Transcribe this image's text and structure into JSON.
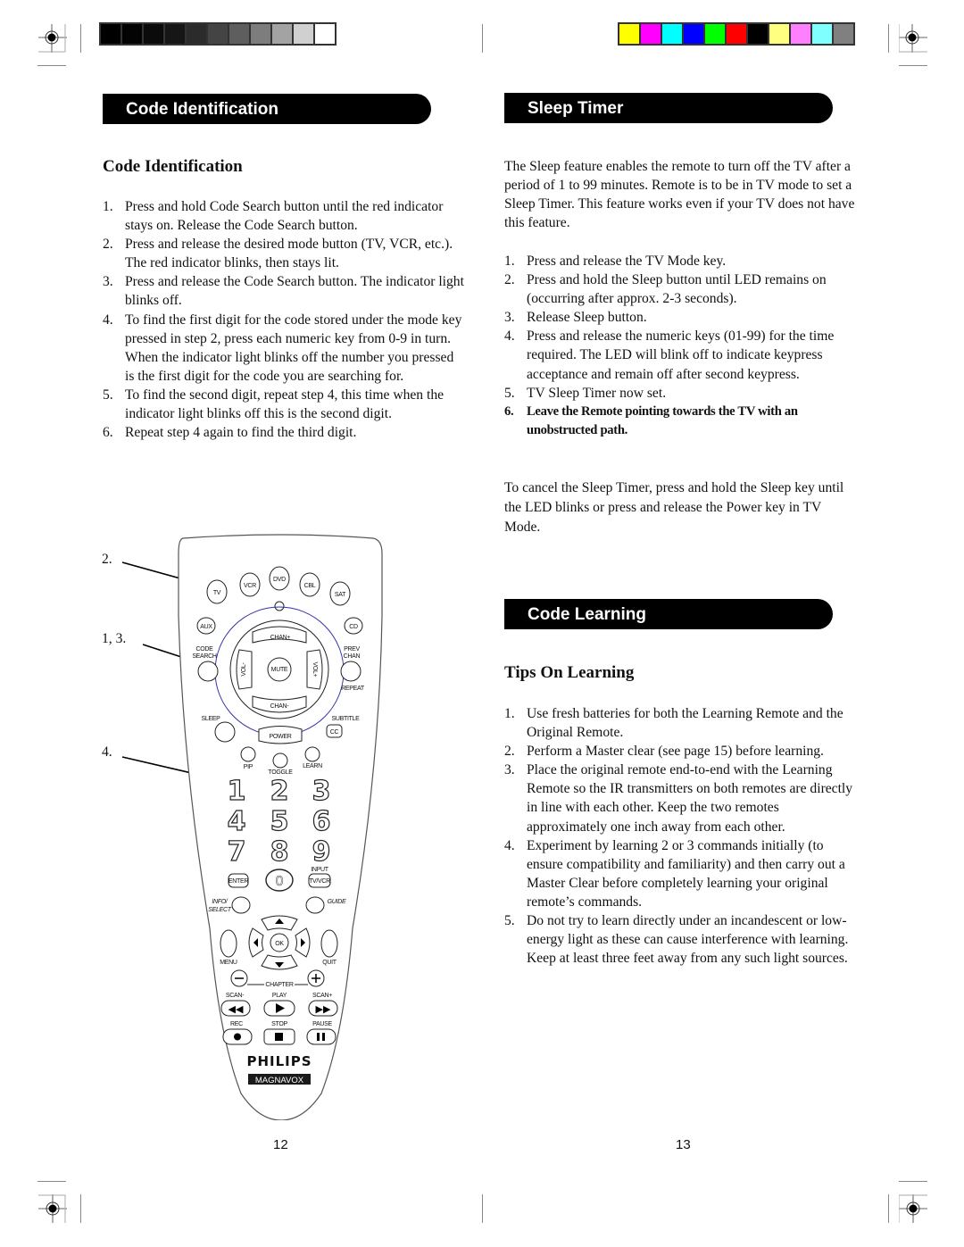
{
  "print_marks": {
    "grayscale_bar": [
      "#000000",
      "#030303",
      "#0b0b0b",
      "#161616",
      "#2b2b2b",
      "#444444",
      "#5e5e5e",
      "#7d7d7d",
      "#a3a3a3",
      "#d0d0d0",
      "#ffffff"
    ],
    "color_bar": [
      "#ffff00",
      "#ff00ff",
      "#00ffff",
      "#0000ff",
      "#00ff00",
      "#ff0000",
      "#000000",
      "#ffff80",
      "#ff80ff",
      "#80ffff",
      "#808080"
    ]
  },
  "left_page": {
    "banner": "Code Identification",
    "heading": "Code Identification",
    "steps": [
      {
        "num": "1.",
        "text": "Press and hold Code Search button until the red indicator stays on. Release the Code Search button."
      },
      {
        "num": "2.",
        "text": "Press and release the desired mode button (TV, VCR, etc.).",
        "note": "The red indicator blinks, then stays lit."
      },
      {
        "num": "3.",
        "text": "Press and release the Code Search button. The indicator light blinks off."
      },
      {
        "num": "4.",
        "text": "To find the first digit for the code stored under the mode key pressed in step 2, press each numeric key from 0-9 in turn. When the indicator light blinks off the number you pressed is the first digit for the code you are searching for."
      },
      {
        "num": "5.",
        "text": "To find the second digit, repeat step 4, this time when the indicator light blinks off this is the second digit."
      },
      {
        "num": "6.",
        "text": "Repeat step 4 again to find the third digit."
      }
    ],
    "callouts": [
      "2.",
      "1, 3.",
      "4."
    ],
    "page_number": "12"
  },
  "remote": {
    "mode_keys": [
      "TV",
      "VCR",
      "DVD",
      "CBL",
      "SAT"
    ],
    "aux": "AUX",
    "cd": "CD",
    "code_search": [
      "CODE",
      "SEARCH"
    ],
    "prev_chan": [
      "PREV",
      "CHAN"
    ],
    "repeat": "REPEAT",
    "chan_up": "CHAN+",
    "chan_down": "CHAN-",
    "vol_down": "VOL-",
    "vol_up": "VOL+",
    "mute": "MUTE",
    "sleep": "SLEEP",
    "subtitle": "SUBTITLE",
    "cc": "CC",
    "power": "POWER",
    "pip": "PIP",
    "toggle": "TOGGLE",
    "learn": "LEARN",
    "digits": [
      "1",
      "2",
      "3",
      "4",
      "5",
      "6",
      "7",
      "8",
      "9",
      "0"
    ],
    "enter": "ENTER",
    "input": "INPUT",
    "tvvcr": "TV/VCR",
    "info_select": [
      "INFO/",
      "SELECT"
    ],
    "guide": "GUIDE",
    "ok": "OK",
    "menu": "MENU",
    "quit": "QUIT",
    "chapter": "CHAPTER",
    "scan_down": "SCAN-",
    "play": "PLAY",
    "scan_up": "SCAN+",
    "rec": "REC",
    "stop": "STOP",
    "pause": "PAUSE",
    "brand": "PHILIPS",
    "sub_brand": "MAGNAVOX",
    "ring_color": "#3333aa"
  },
  "right_page": {
    "sleep_banner": "Sleep Timer",
    "sleep_intro": "The Sleep feature enables the remote to turn off the TV after a period of 1 to 99 minutes. Remote is to be in TV mode to set a Sleep Timer. This feature works even if your TV does not have this feature.",
    "sleep_steps": [
      {
        "num": "1.",
        "text": "Press and release the TV Mode key."
      },
      {
        "num": "2.",
        "text": "Press and hold the Sleep button until LED remains on (occurring after approx. 2-3 seconds)."
      },
      {
        "num": "3.",
        "text": "Release Sleep button."
      },
      {
        "num": "4.",
        "text": "Press and release the numeric keys (01-99) for the time required. The LED will blink off to indicate keypress acceptance and remain off after second keypress."
      },
      {
        "num": "5.",
        "text": "TV Sleep Timer now set."
      },
      {
        "num": "6.",
        "text": "Leave the Remote pointing towards the TV with an unobstructed path."
      }
    ],
    "sleep_cancel": "To cancel the Sleep Timer, press and hold the Sleep key until the LED blinks or press and release the Power key in TV Mode.",
    "learning_banner": "Code Learning",
    "learning_heading": "Tips On Learning",
    "learning_steps": [
      {
        "num": "1.",
        "text": "Use fresh batteries for both the Learning Remote and the Original Remote."
      },
      {
        "num": "2.",
        "text": "Perform a Master clear (see page 15) before learning."
      },
      {
        "num": "3.",
        "text": "Place the original remote end-to-end with the Learning Remote so the IR transmitters on both remotes are directly in line with each other. Keep the two remotes approximately one inch away from each other."
      },
      {
        "num": "4.",
        "text": "Experiment by learning 2 or 3 commands initially (to ensure compatibility and familiarity) and then carry out a Master Clear before completely learning your original remote’s commands."
      },
      {
        "num": "5.",
        "text": "Do not try to learn directly under an incandescent or low-energy light as these can cause interference with learning. Keep at least three feet away from any such light sources."
      }
    ],
    "page_number": "13"
  }
}
